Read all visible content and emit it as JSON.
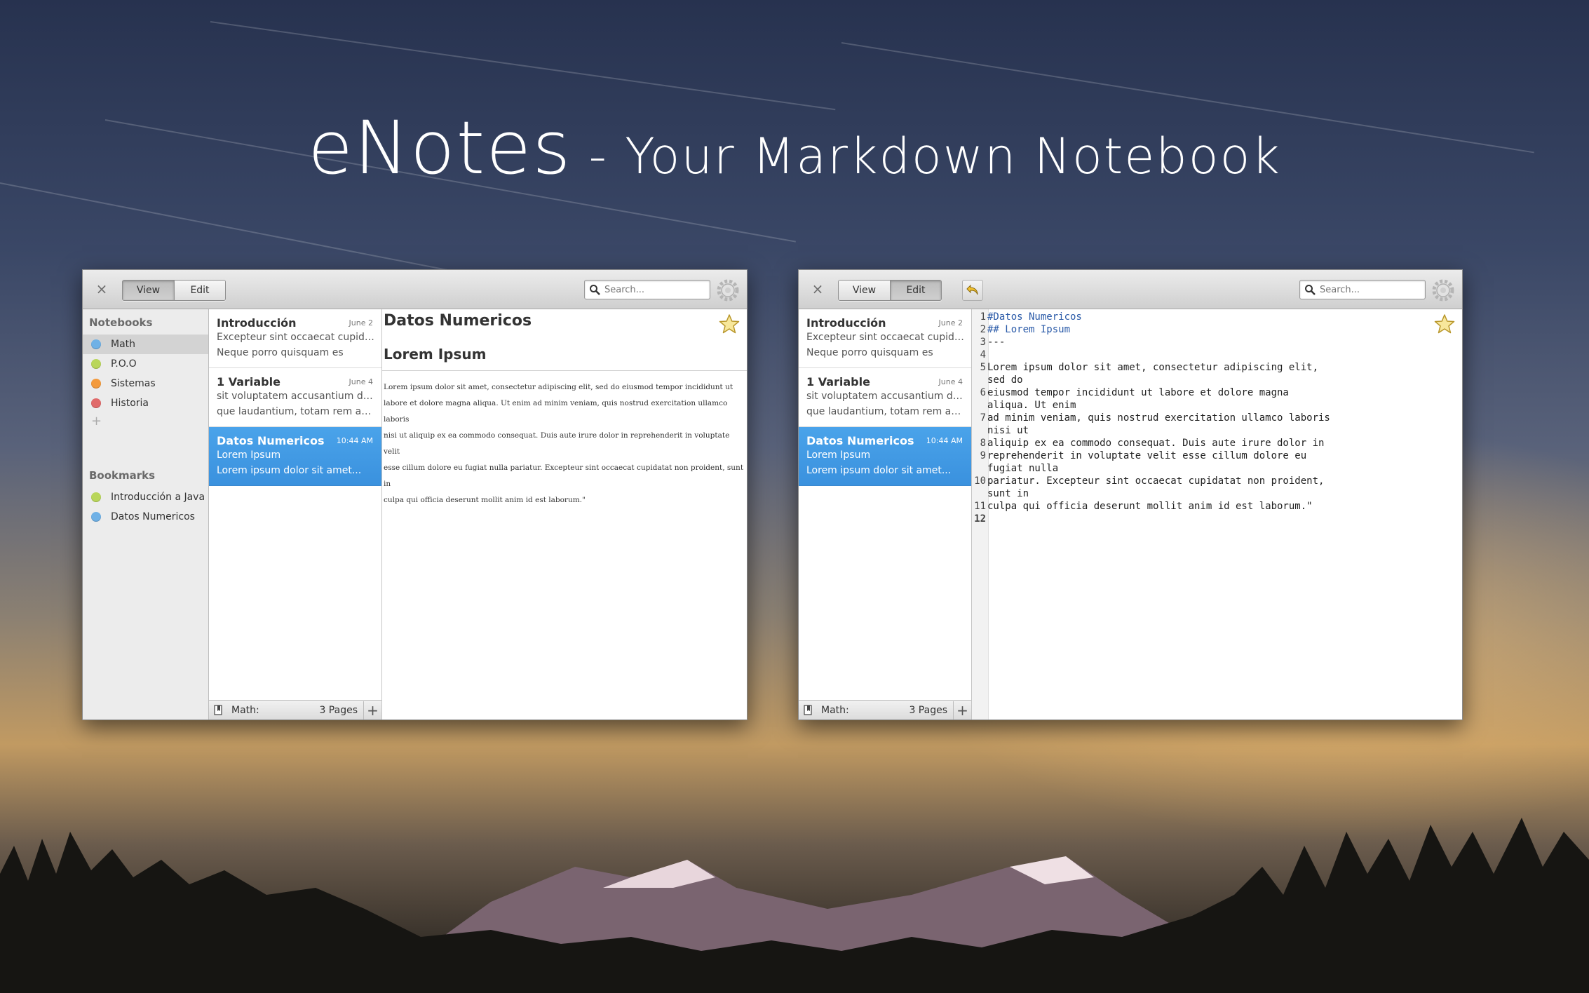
{
  "headline": {
    "brand": "eNotes",
    "tagline": " - Your Markdown Notebook"
  },
  "toolbar": {
    "view_label": "View",
    "edit_label": "Edit",
    "close_glyph": "×",
    "search_placeholder": "Search..."
  },
  "sidebar": {
    "notebooks_header": "Notebooks",
    "notebooks": [
      {
        "label": "Math",
        "color": "#6fb1e6"
      },
      {
        "label": "P.O.O",
        "color": "#b9d65a"
      },
      {
        "label": "Sistemas",
        "color": "#f39a3c"
      },
      {
        "label": "Historia",
        "color": "#e06a6a"
      }
    ],
    "add_glyph": "+",
    "bookmarks_header": "Bookmarks",
    "bookmarks": [
      {
        "label": "Introducción a Java",
        "color": "#b9d65a"
      },
      {
        "label": "Datos Numericos",
        "color": "#6fb1e6"
      }
    ]
  },
  "notes": [
    {
      "title": "Introducción",
      "date": "June 2",
      "line1": "Excepteur sint occaecat cupidatat...",
      "line2": "Neque porro quisquam es"
    },
    {
      "title": "1 Variable",
      "date": "June 4",
      "line1": "sit voluptatem accusantium dolor...",
      "line2": "que laudantium, totam rem aperia..."
    },
    {
      "title": "Datos Numericos",
      "date": "10:44 AM",
      "line1": "Lorem Ipsum",
      "line2": "Lorem ipsum dolor sit amet..."
    }
  ],
  "footer": {
    "notebook": "Math:",
    "pages": "3 Pages",
    "add_glyph": "+"
  },
  "viewer": {
    "h1": "Datos Numericos",
    "h2": "Lorem Ipsum",
    "body_lines": [
      "Lorem ipsum dolor sit amet, consectetur adipiscing elit, sed do eiusmod tempor incididunt ut",
      "labore et dolore magna aliqua. Ut enim ad minim veniam, quis nostrud exercitation ullamco laboris",
      "nisi ut aliquip ex ea commodo consequat. Duis aute irure dolor in reprehenderit in voluptate velit",
      "esse cillum dolore eu fugiat nulla pariatur. Excepteur sint occaecat cupidatat non proident, sunt in",
      "culpa qui officia deserunt mollit anim id est laborum.\""
    ]
  },
  "editor": {
    "lines": [
      {
        "n": "1",
        "parts": [
          "#Datos Numericos"
        ],
        "md": true
      },
      {
        "n": "2",
        "parts": [
          "## Lorem Ipsum"
        ],
        "md": true
      },
      {
        "n": "3",
        "parts": [
          "---"
        ]
      },
      {
        "n": "4",
        "parts": [
          ""
        ]
      },
      {
        "n": "5",
        "parts": [
          "Lorem ipsum dolor sit amet, consectetur adipiscing elit,",
          "sed do"
        ]
      },
      {
        "n": "6",
        "parts": [
          "eiusmod tempor incididunt ut labore et dolore magna",
          "aliqua. Ut enim"
        ]
      },
      {
        "n": "7",
        "parts": [
          "ad minim veniam, quis nostrud exercitation ullamco laboris",
          "nisi ut"
        ]
      },
      {
        "n": "8",
        "parts": [
          "aliquip ex ea commodo consequat. Duis aute irure dolor in"
        ]
      },
      {
        "n": "9",
        "parts": [
          "reprehenderit in voluptate velit esse cillum dolore eu",
          "fugiat nulla"
        ]
      },
      {
        "n": "10",
        "parts": [
          "pariatur. Excepteur sint occaecat cupidatat non proident,",
          "sunt in"
        ]
      },
      {
        "n": "11",
        "parts": [
          "culpa qui officia deserunt mollit anim id est laborum.\""
        ]
      },
      {
        "n": "12",
        "parts": [
          ""
        ],
        "current": true
      }
    ]
  },
  "colors": {
    "accent": "#3a91de"
  }
}
